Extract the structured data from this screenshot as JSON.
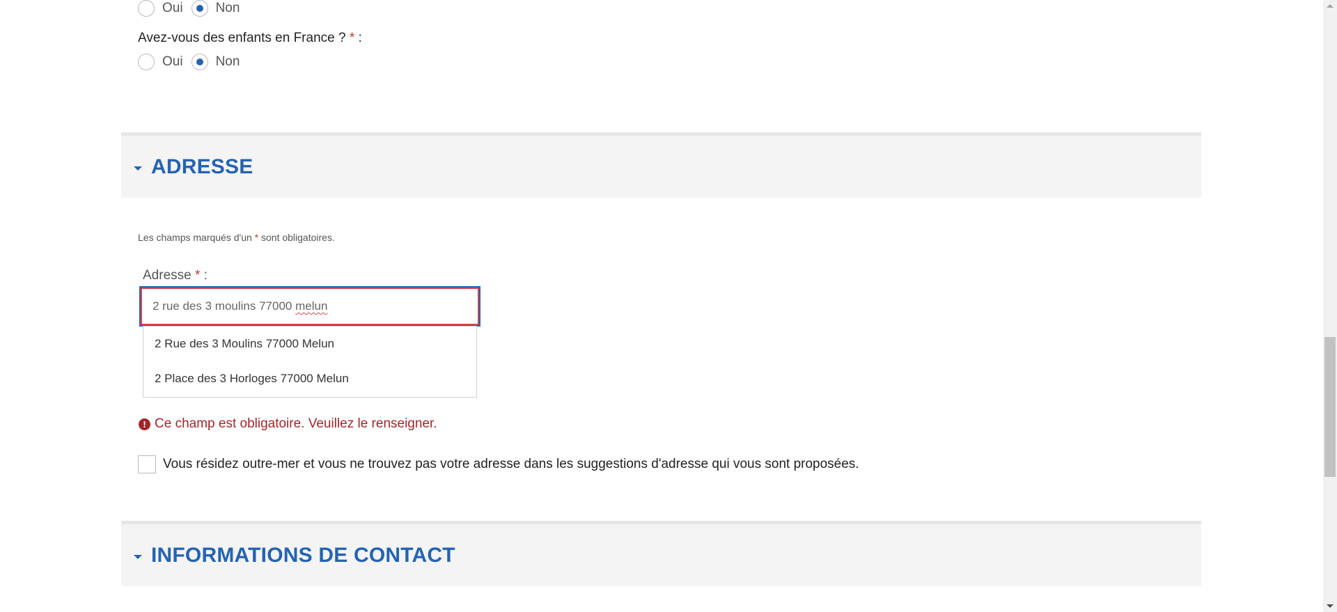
{
  "question_prev": {
    "options": [
      "Oui",
      "Non"
    ],
    "selected": "Non"
  },
  "question_children": {
    "label": "Avez-vous des enfants en France ?",
    "required_mark": "*",
    "suffix": ":",
    "options": [
      "Oui",
      "Non"
    ],
    "selected": "Non"
  },
  "address_section": {
    "title": "ADRESSE",
    "note_before": "Les champs marqués d'un",
    "note_mark": "*",
    "note_after": "sont obligatoires.",
    "field_label": "Adresse",
    "field_required_mark": "*",
    "field_suffix": ":",
    "input_value_start": "2 rue des 3 moulins 77000 ",
    "input_value_misspelled": "melun",
    "suggestions": [
      "2 Rue des 3 Moulins 77000 Melun",
      "2 Place des 3 Horloges 77000 Melun"
    ],
    "error_icon": "!",
    "error": "Ce champ est obligatoire. Veuillez le renseigner.",
    "overseas_checkbox_label": "Vous résidez outre-mer et vous ne trouvez pas votre adresse dans les suggestions d'adresse qui vous sont proposées."
  },
  "contact_section": {
    "title": "INFORMATIONS DE CONTACT"
  },
  "colors": {
    "accent": "#2563b0",
    "error": "#a3262a",
    "required": "#c0392b",
    "section_bg": "#f4f4f4"
  }
}
